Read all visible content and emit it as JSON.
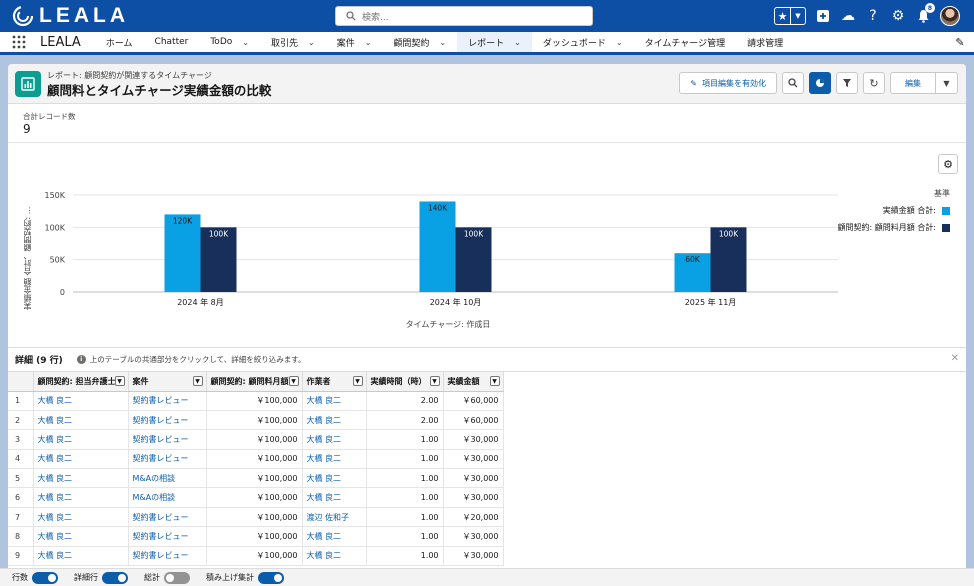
{
  "app": {
    "logo_text": "LEALA",
    "search_placeholder": "検索...",
    "notification_count": "8",
    "name": "LEALA"
  },
  "nav": {
    "items": [
      {
        "label": "ホーム",
        "dropdown": false
      },
      {
        "label": "Chatter",
        "dropdown": false
      },
      {
        "label": "ToDo",
        "dropdown": true
      },
      {
        "label": "取引先",
        "dropdown": true
      },
      {
        "label": "案件",
        "dropdown": true
      },
      {
        "label": "顧問契約",
        "dropdown": true
      },
      {
        "label": "レポート",
        "dropdown": true,
        "active": true
      },
      {
        "label": "ダッシュボード",
        "dropdown": true
      },
      {
        "label": "タイムチャージ管理",
        "dropdown": false
      },
      {
        "label": "請求管理",
        "dropdown": false
      }
    ]
  },
  "report": {
    "subtitle": "レポート: 顧問契約が関連するタイムチャージ",
    "title": "顧問料とタイムチャージ実績金額の比較",
    "enable_edit_label": "項目編集を有効化",
    "edit_label": "編集",
    "total_label": "合計レコード数",
    "total_value": "9"
  },
  "chart_data": {
    "type": "bar",
    "categories": [
      "2024 年 8月",
      "2024 年 10月",
      "2025 年 11月"
    ],
    "series": [
      {
        "name": "実績金額 合計:",
        "color": "#0aa0e4",
        "values": [
          120000,
          140000,
          60000
        ],
        "labels": [
          "120K",
          "140K",
          "60K"
        ]
      },
      {
        "name": "顧問契約: 顧問料月額 合計:",
        "color": "#172f5a",
        "values": [
          100000,
          100000,
          100000
        ],
        "labels": [
          "100K",
          "100K",
          "100K"
        ]
      }
    ],
    "yticks": [
      "0",
      "50K",
      "100K",
      "150K"
    ],
    "ylim": [
      0,
      150000
    ],
    "ylabel": "実績金額 合計、顧問契約: ...",
    "xlabel": "タイムチャージ: 作成日",
    "legend_title": "基準",
    "legend_position": "right",
    "grid": true
  },
  "details": {
    "title": "詳細 (9 行)",
    "hint": "上のテーブルの共通部分をクリックして、詳細を絞り込みます。",
    "columns": [
      "顧問契約: 担当弁護士",
      "案件",
      "顧問契約: 顧問料月額",
      "作業者",
      "実績時間（時）",
      "実績金額"
    ],
    "rows": [
      [
        "1",
        "大橋 良二",
        "契約書レビュー",
        "￥100,000",
        "大橋 良二",
        "2.00",
        "￥60,000"
      ],
      [
        "2",
        "大橋 良二",
        "契約書レビュー",
        "￥100,000",
        "大橋 良二",
        "2.00",
        "￥60,000"
      ],
      [
        "3",
        "大橋 良二",
        "契約書レビュー",
        "￥100,000",
        "大橋 良二",
        "1.00",
        "￥30,000"
      ],
      [
        "4",
        "大橋 良二",
        "契約書レビュー",
        "￥100,000",
        "大橋 良二",
        "1.00",
        "￥30,000"
      ],
      [
        "5",
        "大橋 良二",
        "M&Aの相談",
        "￥100,000",
        "大橋 良二",
        "1.00",
        "￥30,000"
      ],
      [
        "6",
        "大橋 良二",
        "M&Aの相談",
        "￥100,000",
        "大橋 良二",
        "1.00",
        "￥30,000"
      ],
      [
        "7",
        "大橋 良二",
        "契約書レビュー",
        "￥100,000",
        "渡辺 佐和子",
        "1.00",
        "￥20,000"
      ],
      [
        "8",
        "大橋 良二",
        "契約書レビュー",
        "￥100,000",
        "大橋 良二",
        "1.00",
        "￥30,000"
      ],
      [
        "9",
        "大橋 良二",
        "契約書レビュー",
        "￥100,000",
        "大橋 良二",
        "1.00",
        "￥30,000"
      ]
    ]
  },
  "footer": {
    "toggles": [
      {
        "label": "行数",
        "on": true
      },
      {
        "label": "詳細行",
        "on": true
      },
      {
        "label": "総計",
        "on": false
      },
      {
        "label": "積み上げ集計",
        "on": true
      }
    ]
  }
}
